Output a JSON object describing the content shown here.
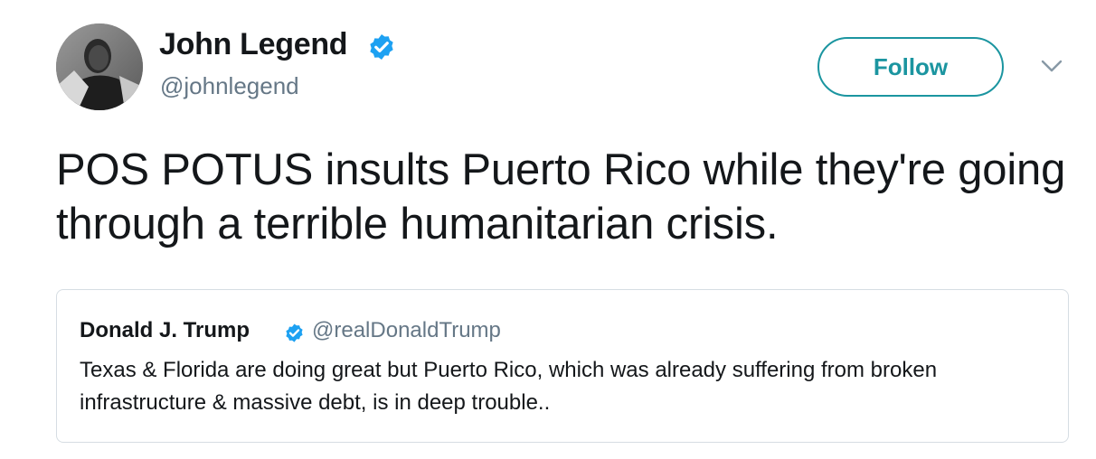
{
  "author": {
    "name": "John Legend",
    "handle": "@johnlegend",
    "verified": true
  },
  "follow_button": {
    "label": "Follow"
  },
  "tweet": {
    "text": "POS POTUS insults Puerto Rico while they're going through a terrible humanitarian crisis."
  },
  "quoted_tweet": {
    "name": "Donald J. Trump",
    "handle": "@realDonaldTrump",
    "verified": true,
    "text": "Texas & Florida are doing great but Puerto Rico, which was already suffering from broken infrastructure & massive debt, is in deep trouble.."
  },
  "icons": {
    "verified": "verified-badge-icon",
    "more": "chevron-down-icon"
  },
  "colors": {
    "verified": "#1da1f2",
    "follow_accent": "#1b95a0",
    "secondary_text": "#657786",
    "primary_text": "#14171a",
    "card_border": "#d6dde3"
  }
}
